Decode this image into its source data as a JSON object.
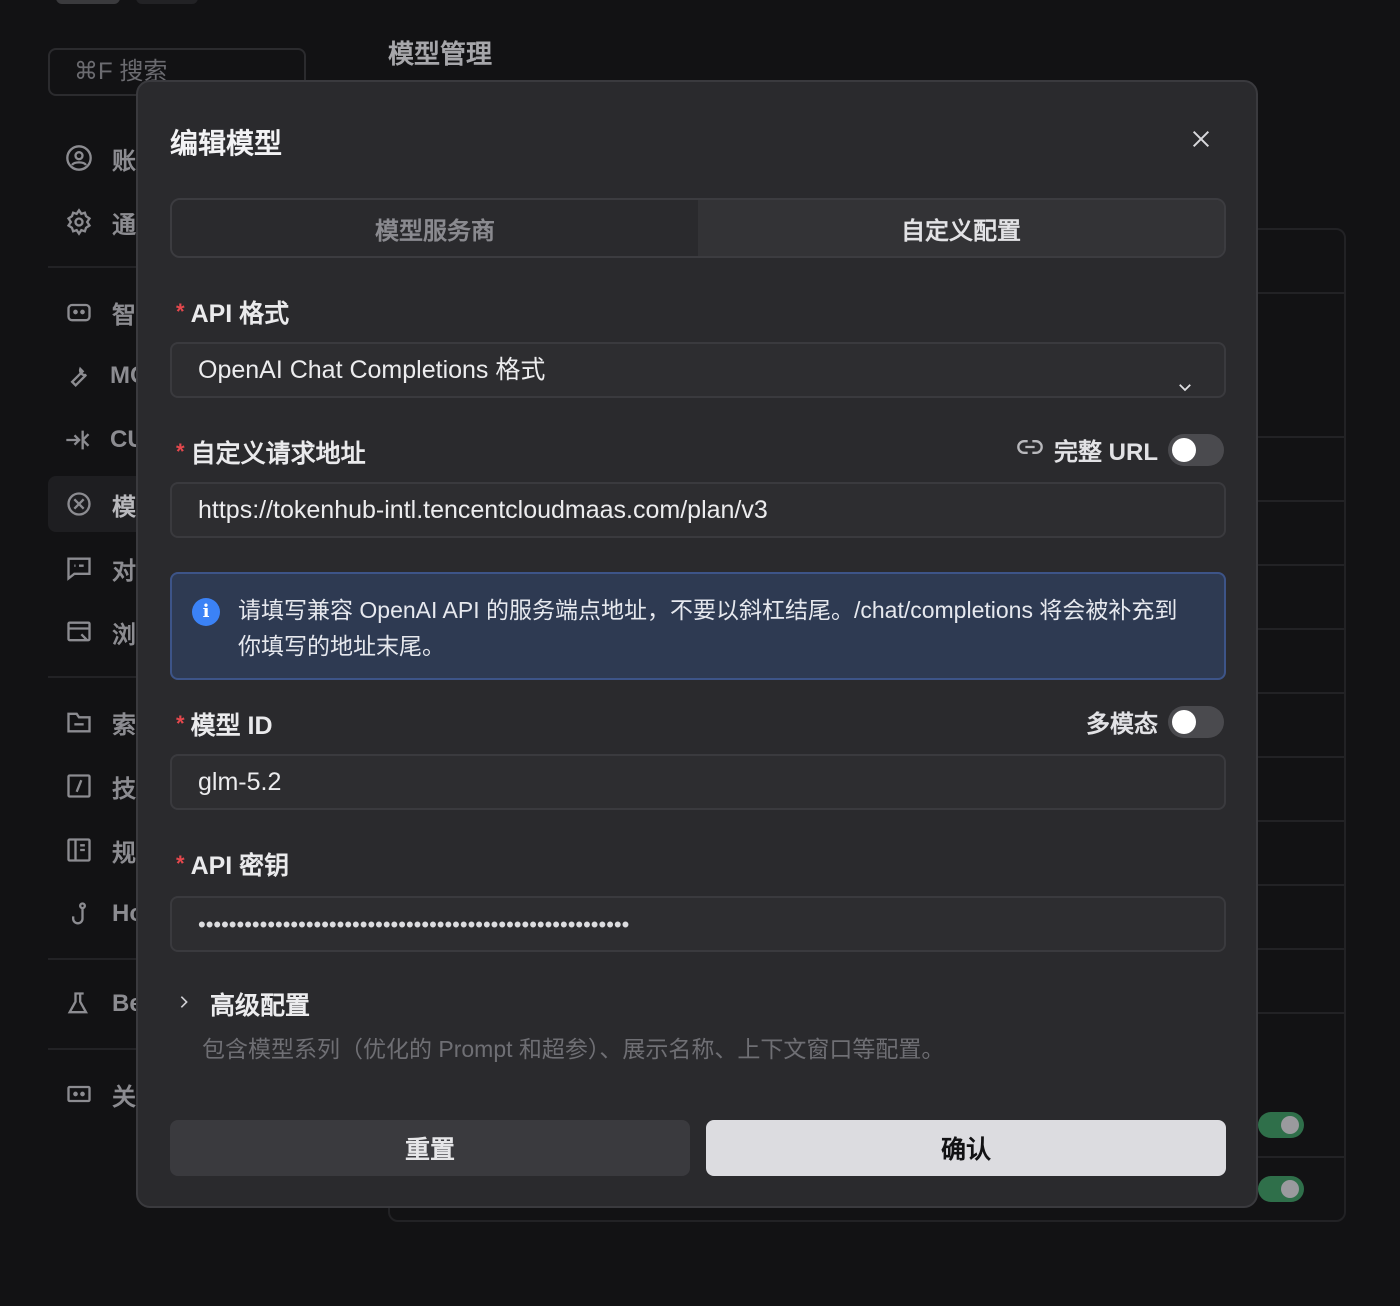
{
  "background": {
    "search_placeholder": "⌘F 搜索",
    "page_title": "模型管理",
    "sidebar": [
      {
        "icon": "user-circle-icon",
        "label": "账"
      },
      {
        "icon": "gear-icon",
        "label": "通"
      },
      {
        "icon": "robot-icon",
        "label": "智"
      },
      {
        "icon": "wrench-icon",
        "label": "MC"
      },
      {
        "icon": "cursor-arrow-icon",
        "label": "CU"
      },
      {
        "icon": "model-icon",
        "label": "模"
      },
      {
        "icon": "chat-icon",
        "label": "对"
      },
      {
        "icon": "browser-icon",
        "label": "浏"
      },
      {
        "icon": "folder-icon",
        "label": "索"
      },
      {
        "icon": "skill-icon",
        "label": "技"
      },
      {
        "icon": "book-icon",
        "label": "规"
      },
      {
        "icon": "hook-icon",
        "label": "Ho"
      },
      {
        "icon": "flask-icon",
        "label": "Be"
      },
      {
        "icon": "about-icon",
        "label": "关"
      }
    ]
  },
  "modal": {
    "title": "编辑模型",
    "tabs": [
      {
        "label": "模型服务商",
        "active": false
      },
      {
        "label": "自定义配置",
        "active": true
      }
    ],
    "api_format": {
      "label": "API 格式",
      "value": "OpenAI Chat Completions 格式"
    },
    "request_url": {
      "label": "自定义请求地址",
      "full_url_label": "完整 URL",
      "full_url_enabled": false,
      "value": "https://tokenhub-intl.tencentcloudmaas.com/plan/v3"
    },
    "info": {
      "text": "请填写兼容 OpenAI API 的服务端点地址，不要以斜杠结尾。/chat/completions 将会被补充到你填写的地址末尾。"
    },
    "model_id": {
      "label": "模型 ID",
      "multimodal_label": "多模态",
      "multimodal_enabled": false,
      "value": "glm-5.2"
    },
    "api_key": {
      "label": "API 密钥",
      "masked_value": "••••••••••••••••••••••••••••••••••••••••••••••••••••••••"
    },
    "advanced": {
      "title": "高级配置",
      "description": "包含模型系列（优化的 Prompt 和超参）、展示名称、上下文窗口等配置。"
    },
    "buttons": {
      "reset": "重置",
      "confirm": "确认"
    },
    "required_mark": "*"
  },
  "colors": {
    "required": "#e5484d",
    "info_bg": "#2e3a52",
    "info_border": "#3d5488",
    "info_icon": "#3b82f6",
    "bg_toggle_on": "#2f6f4a"
  }
}
